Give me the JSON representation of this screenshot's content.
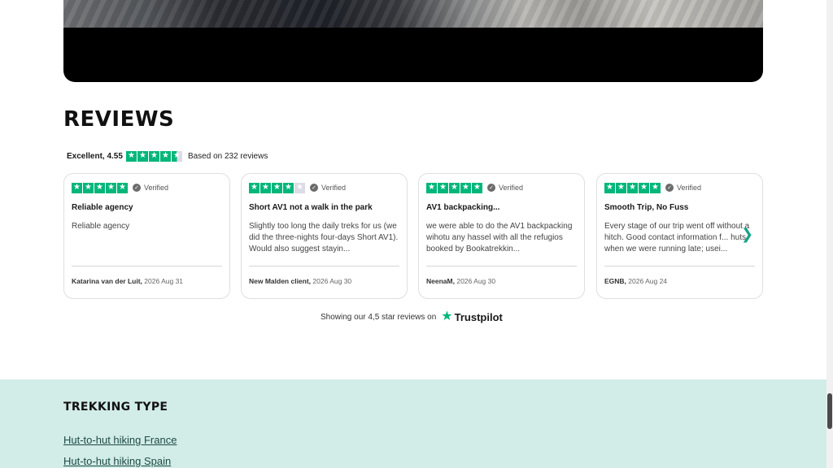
{
  "reviews": {
    "heading": "REVIEWS",
    "summary": {
      "label": "Excellent, 4.55",
      "rating_stars": 4.5,
      "based_on": "Based on 232 reviews"
    },
    "verified_label": "Verified",
    "cards": [
      {
        "stars": 5,
        "title": "Reliable agency",
        "body": "Reliable agency",
        "author": "Katarina van der Luit,",
        "date": "2026 Aug 31"
      },
      {
        "stars": 4,
        "title": "Short AV1 not a walk in the park",
        "body": "Slightly too long the daily treks for us (we did the three-nights four-days Short AV1). Would also suggest stayin...",
        "author": "New Malden client,",
        "date": "2026 Aug 30"
      },
      {
        "stars": 5,
        "title": "AV1 backpacking...",
        "body": "we were able to do the AV1 backpacking wihotu any hassel with all the refugios booked by Bookatrekkin...",
        "author": "NeenaM,",
        "date": "2026 Aug 30"
      },
      {
        "stars": 5,
        "title": "Smooth Trip, No Fuss",
        "body": "Every stage of our trip went off without a hitch. Good contact information f... huts when we were running late; usei...",
        "author": "EGNB,",
        "date": "2026 Aug 24"
      }
    ],
    "trustpilot": {
      "showing_text": "Showing our 4,5 star reviews on",
      "brand": "Trustpilot"
    }
  },
  "trekking_type": {
    "heading": "TREKKING TYPE",
    "links": [
      "Hut-to-hut hiking France",
      "Hut-to-hut hiking Spain"
    ]
  },
  "colors": {
    "trustpilot_green": "#00b67a",
    "section_bg": "#d2ece8",
    "arrow": "#17a288"
  }
}
